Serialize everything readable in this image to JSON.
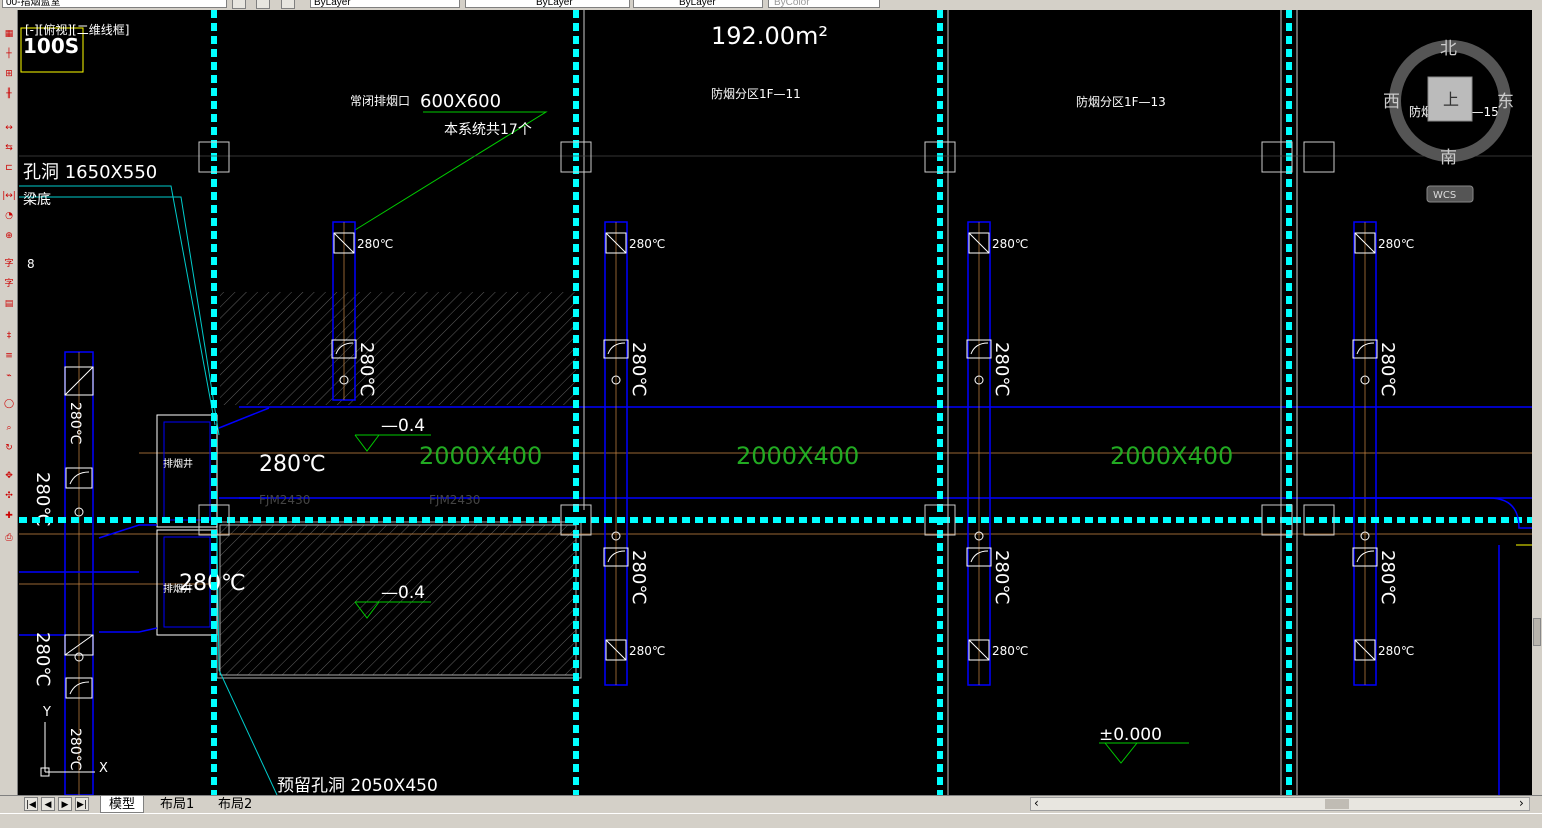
{
  "toolbar": {
    "layer_name": "00-指烟蓝室",
    "color_value": "ByLayer",
    "linetype_value": "ByLayer",
    "lineweight_value": "ByLayer",
    "plotstyle_value": "ByColor"
  },
  "viewport": {
    "label": "[-][俯视][二维线框]",
    "scale_label": "100S"
  },
  "drawing": {
    "area_label": "192.00m²",
    "zone_11": "防烟分区1F—11",
    "zone_13": "防烟分区1F—13",
    "zone_15": "防烟分区1F—15",
    "exhaust_outlet": "常闭排烟口",
    "outlet_size": "600X600",
    "outlet_count": "本系统共17个",
    "opening_left": "孔洞 1650X550",
    "beam_bottom": "梁底",
    "left_num": "8",
    "opening_bottom": "预留孔洞 2050X450",
    "duct_size": "2000X400",
    "elev_neg": "—0.4",
    "elev_zero": "±0.000",
    "damper_temp": "280℃",
    "shaft_label": "排烟井",
    "tag_fjm": "FJM2430",
    "riser_label": "排烟竖井",
    "axis_y": "Y",
    "axis_x": "X"
  },
  "compass": {
    "north": "北",
    "south": "南",
    "east": "东",
    "west": "西",
    "top": "上",
    "wcs": "WCS"
  },
  "tabs": [
    "模型",
    "布局1",
    "布局2"
  ],
  "colors": {
    "background": "#000000",
    "axis_grid": "#00ffff",
    "duct_outline": "#0000ff",
    "duct_label": "#22aa22",
    "text": "#ffffff"
  }
}
